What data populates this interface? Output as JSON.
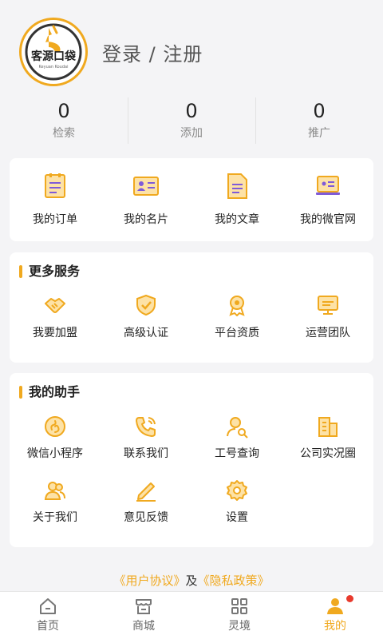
{
  "header": {
    "logo_text": "客源口袋",
    "logo_sub": "Keyuan Koudai",
    "login_text": "登录 / 注册"
  },
  "stats": [
    {
      "value": "0",
      "label": "检索"
    },
    {
      "value": "0",
      "label": "添加"
    },
    {
      "value": "0",
      "label": "推广"
    }
  ],
  "quick": [
    {
      "label": "我的订单",
      "icon": "order-icon"
    },
    {
      "label": "我的名片",
      "icon": "card-icon"
    },
    {
      "label": "我的文章",
      "icon": "article-icon"
    },
    {
      "label": "我的微官网",
      "icon": "website-icon"
    }
  ],
  "services": {
    "title": "更多服务",
    "items": [
      {
        "label": "我要加盟",
        "icon": "handshake-icon"
      },
      {
        "label": "高级认证",
        "icon": "shield-check-icon"
      },
      {
        "label": "平台资质",
        "icon": "badge-icon"
      },
      {
        "label": "运营团队",
        "icon": "monitor-icon"
      }
    ]
  },
  "assistant": {
    "title": "我的助手",
    "items": [
      {
        "label": "微信小程序",
        "icon": "mini-program-icon"
      },
      {
        "label": "联系我们",
        "icon": "phone-icon"
      },
      {
        "label": "工号查询",
        "icon": "user-search-icon"
      },
      {
        "label": "公司实况圈",
        "icon": "building-icon"
      },
      {
        "label": "关于我们",
        "icon": "users-icon"
      },
      {
        "label": "意见反馈",
        "icon": "pencil-icon"
      },
      {
        "label": "设置",
        "icon": "gear-icon"
      }
    ]
  },
  "agreement": {
    "user_agreement": "《用户协议》",
    "and": "及",
    "privacy_policy": "《隐私政策》"
  },
  "tabbar": [
    {
      "label": "首页",
      "icon": "home-icon"
    },
    {
      "label": "商城",
      "icon": "store-icon"
    },
    {
      "label": "灵境",
      "icon": "grid-icon"
    },
    {
      "label": "我的",
      "icon": "person-icon",
      "active": true
    }
  ],
  "colors": {
    "accent": "#f0a91f",
    "badge": "#e83a2d",
    "background": "#f4f4f6"
  }
}
